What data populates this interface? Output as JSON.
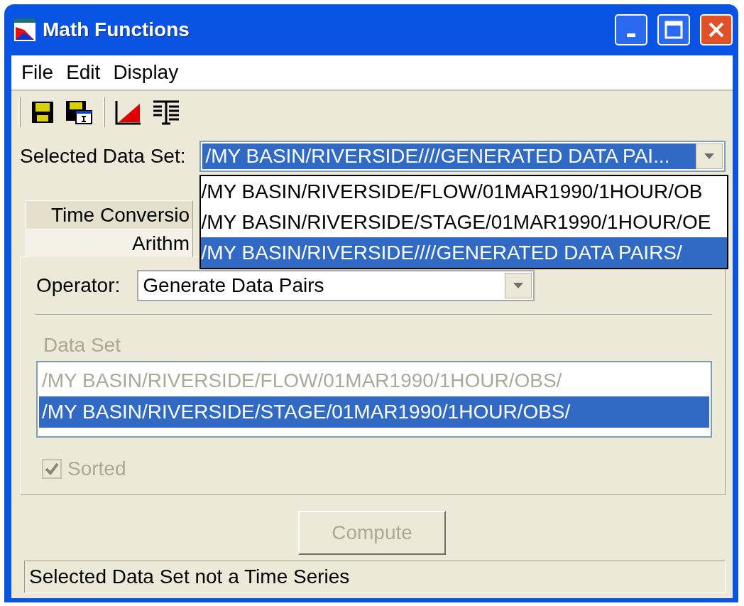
{
  "window": {
    "title": "Math Functions"
  },
  "menu": [
    "File",
    "Edit",
    "Display"
  ],
  "selected_data_set": {
    "label": "Selected Data Set:",
    "value": "/MY BASIN/RIVERSIDE////GENERATED DATA PAI...",
    "expanded": true,
    "options": [
      {
        "label": "/MY BASIN/RIVERSIDE/FLOW/01MAR1990/1HOUR/OB",
        "selected": false
      },
      {
        "label": "/MY BASIN/RIVERSIDE/STAGE/01MAR1990/1HOUR/OE",
        "selected": false
      },
      {
        "label": "/MY BASIN/RIVERSIDE////GENERATED DATA PAIRS/",
        "selected": true
      }
    ]
  },
  "tabs": [
    [
      {
        "label": "Time Conversio",
        "selected": false
      }
    ],
    [
      {
        "label": "Arithm",
        "selected": true
      }
    ]
  ],
  "operator": {
    "label": "Operator:",
    "value": "Generate Data Pairs"
  },
  "data_set": {
    "label": "Data Set",
    "disabled": true,
    "items": [
      {
        "label": "/MY BASIN/RIVERSIDE/FLOW/01MAR1990/1HOUR/OBS/",
        "selected": false
      },
      {
        "label": "/MY BASIN/RIVERSIDE/STAGE/01MAR1990/1HOUR/OBS/",
        "selected": true
      }
    ]
  },
  "sorted": {
    "label": "Sorted",
    "checked": true,
    "disabled": true
  },
  "compute": {
    "label": "Compute",
    "disabled": true
  },
  "status_bar": "Selected Data Set not a Time Series"
}
